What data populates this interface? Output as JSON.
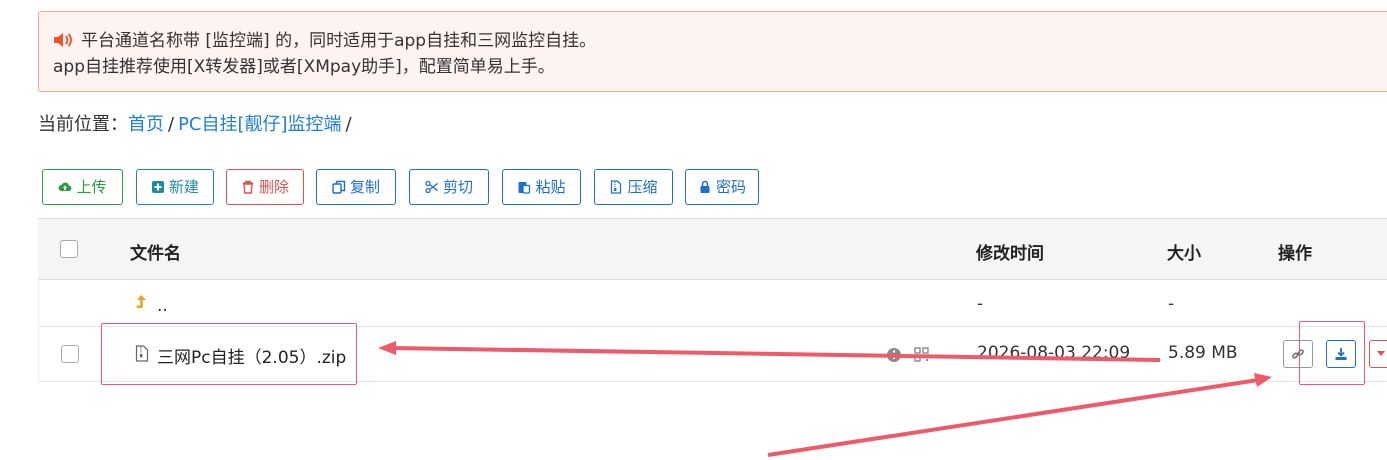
{
  "notice": {
    "line1": "平台通道名称带 [监控端] 的，同时适用于app自挂和三网监控自挂。",
    "line2": "app自挂推荐使用[X转发器]或者[XMpay助手]，配置简单易上手。",
    "icon": "speaker-icon"
  },
  "breadcrumb": {
    "label": "当前位置：",
    "home": "首页",
    "sep1": "/",
    "folder": "PC自挂[靓仔]监控端",
    "sep2": "/"
  },
  "toolbar": {
    "upload": "上传",
    "new": "新建",
    "delete": "删除",
    "copy": "复制",
    "cut": "剪切",
    "paste": "粘贴",
    "compress": "压缩",
    "password": "密码"
  },
  "table": {
    "headers": {
      "name": "文件名",
      "modified": "修改时间",
      "size": "大小",
      "actions": "操作"
    },
    "parent_row": {
      "name": "..",
      "modified": "-",
      "size": "-"
    },
    "file_row": {
      "name": "三网Pc自挂（2.05）.zip",
      "modified": "2026-08-03 22:09",
      "size": "5.89 MB"
    }
  },
  "colors": {
    "annotation": "#ee5a6a",
    "link": "#1e7fd6",
    "notice_bg": "#fdf3f1"
  }
}
